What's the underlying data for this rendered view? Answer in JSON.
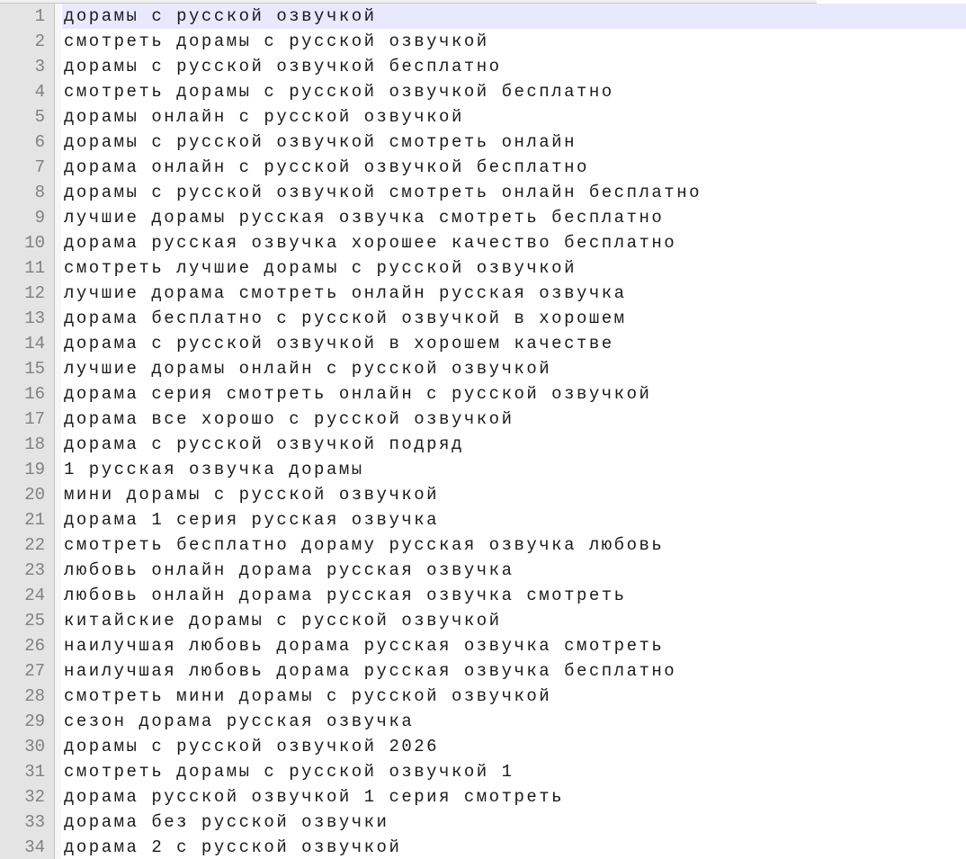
{
  "editor": {
    "current_line": 1,
    "lines": [
      {
        "no": "1",
        "text": "дорамы с русской озвучкой"
      },
      {
        "no": "2",
        "text": "смотреть дорамы с русской озвучкой"
      },
      {
        "no": "3",
        "text": "дорамы с русской озвучкой бесплатно"
      },
      {
        "no": "4",
        "text": "смотреть дорамы с русской озвучкой бесплатно"
      },
      {
        "no": "5",
        "text": "дорамы онлайн с русской озвучкой"
      },
      {
        "no": "6",
        "text": "дорамы с русской озвучкой смотреть онлайн"
      },
      {
        "no": "7",
        "text": "дорама онлайн с русской озвучкой бесплатно"
      },
      {
        "no": "8",
        "text": "дорамы с русской озвучкой смотреть онлайн бесплатно"
      },
      {
        "no": "9",
        "text": "лучшие дорамы русская озвучка смотреть бесплатно"
      },
      {
        "no": "10",
        "text": "дорама русская озвучка хорошее качество бесплатно"
      },
      {
        "no": "11",
        "text": "смотреть лучшие дорамы с русской озвучкой"
      },
      {
        "no": "12",
        "text": "лучшие дорама смотреть онлайн русская озвучка"
      },
      {
        "no": "13",
        "text": "дорама бесплатно с русской озвучкой в хорошем"
      },
      {
        "no": "14",
        "text": "дорама с русской озвучкой в хорошем качестве"
      },
      {
        "no": "15",
        "text": "лучшие дорамы онлайн с русской озвучкой"
      },
      {
        "no": "16",
        "text": "дорама серия смотреть онлайн с русской озвучкой"
      },
      {
        "no": "17",
        "text": "дорама все хорошо с русской озвучкой"
      },
      {
        "no": "18",
        "text": "дорама с русской озвучкой подряд"
      },
      {
        "no": "19",
        "text": "1 русская озвучка дорамы"
      },
      {
        "no": "20",
        "text": "мини дорамы с русской озвучкой"
      },
      {
        "no": "21",
        "text": "дорама 1 серия русская озвучка"
      },
      {
        "no": "22",
        "text": "смотреть бесплатно дораму русская озвучка любовь"
      },
      {
        "no": "23",
        "text": "любовь онлайн дорама русская озвучка"
      },
      {
        "no": "24",
        "text": "любовь онлайн дорама русская озвучка смотреть"
      },
      {
        "no": "25",
        "text": "китайские дорамы с русской озвучкой"
      },
      {
        "no": "26",
        "text": "наилучшая любовь дорама русская озвучка смотреть"
      },
      {
        "no": "27",
        "text": "наилучшая любовь дорама русская озвучка бесплатно"
      },
      {
        "no": "28",
        "text": "смотреть мини дорамы с русской озвучкой"
      },
      {
        "no": "29",
        "text": "сезон дорама русская озвучка"
      },
      {
        "no": "30",
        "text": "дорамы с русской озвучкой 2026"
      },
      {
        "no": "31",
        "text": "смотреть дорамы с русской озвучкой 1"
      },
      {
        "no": "32",
        "text": "дорама русской озвучкой 1 серия смотреть"
      },
      {
        "no": "33",
        "text": "дорама без русской озвучки"
      },
      {
        "no": "34",
        "text": "дорама 2 с русской озвучкой"
      }
    ]
  },
  "colors": {
    "gutter_bg": "#e4e4e4",
    "line_number": "#808080",
    "text": "#1a1a1a",
    "current_line_bg": "#e8e8ff",
    "background": "#ffffff"
  }
}
